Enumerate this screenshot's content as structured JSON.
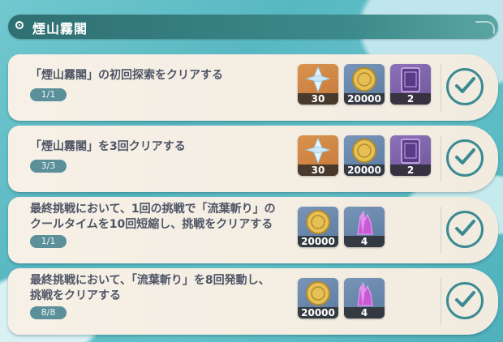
{
  "header": {
    "title": "煙山霧閣"
  },
  "missions": [
    {
      "title_lines": [
        "「煙山霧閣」の初回探索をクリアする"
      ],
      "progress": "1/1",
      "rewards": [
        {
          "icon": "primogem-icon",
          "count": "30",
          "rarity": "rarity-5"
        },
        {
          "icon": "mora-icon",
          "count": "20000",
          "rarity": "rarity-3"
        },
        {
          "icon": "book-icon",
          "count": "2",
          "rarity": "rarity-4"
        }
      ],
      "completed": true
    },
    {
      "title_lines": [
        "「煙山霧閣」を3回クリアする"
      ],
      "progress": "3/3",
      "rewards": [
        {
          "icon": "primogem-icon",
          "count": "30",
          "rarity": "rarity-5"
        },
        {
          "icon": "mora-icon",
          "count": "20000",
          "rarity": "rarity-3"
        },
        {
          "icon": "book-icon",
          "count": "2",
          "rarity": "rarity-4"
        }
      ],
      "completed": true
    },
    {
      "title_lines": [
        "最終挑戦において、1回の挑戦で「流葉斬り」の",
        "クールタイムを10回短縮し、挑戦をクリアする"
      ],
      "progress": "1/1",
      "rewards": [
        {
          "icon": "mora-icon",
          "count": "20000",
          "rarity": "rarity-3"
        },
        {
          "icon": "crystal-icon",
          "count": "4",
          "rarity": "rarity-3"
        }
      ],
      "completed": true
    },
    {
      "title_lines": [
        "最終挑戦において、「流葉斬り」を8回発動し、",
        "挑戦をクリアする"
      ],
      "progress": "8/8",
      "rewards": [
        {
          "icon": "mora-icon",
          "count": "20000",
          "rarity": "rarity-3"
        },
        {
          "icon": "crystal-icon",
          "count": "4",
          "rarity": "rarity-3"
        }
      ],
      "completed": true
    }
  ]
}
